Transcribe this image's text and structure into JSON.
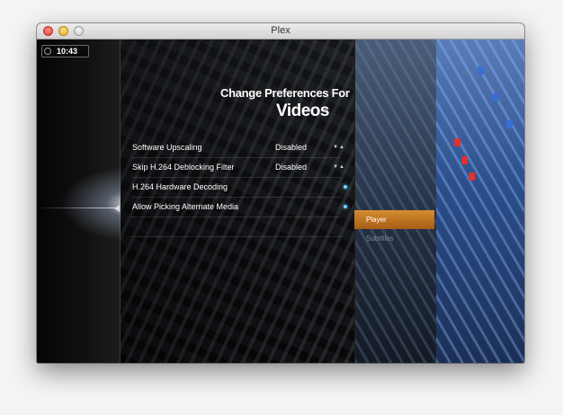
{
  "window": {
    "title": "Plex"
  },
  "clock": {
    "time": "10:43"
  },
  "page": {
    "heading_pre": "Change Preferences For",
    "heading_main": "Videos"
  },
  "settings": [
    {
      "label": "Software Upscaling",
      "value": "Disabled",
      "control": "stepper"
    },
    {
      "label": "Skip H.264 Deblocking Filter",
      "value": "Disabled",
      "control": "stepper"
    },
    {
      "label": "H.264 Hardware Decoding",
      "value": "",
      "control": "toggle"
    },
    {
      "label": "Allow Picking Alternate Media",
      "value": "",
      "control": "toggle"
    }
  ],
  "menu": [
    {
      "label": "Player",
      "active": true
    },
    {
      "label": "Subtitles",
      "active": false
    }
  ],
  "colors": {
    "accent": "#c77a24",
    "toggle_on": "#6fd4ff"
  }
}
